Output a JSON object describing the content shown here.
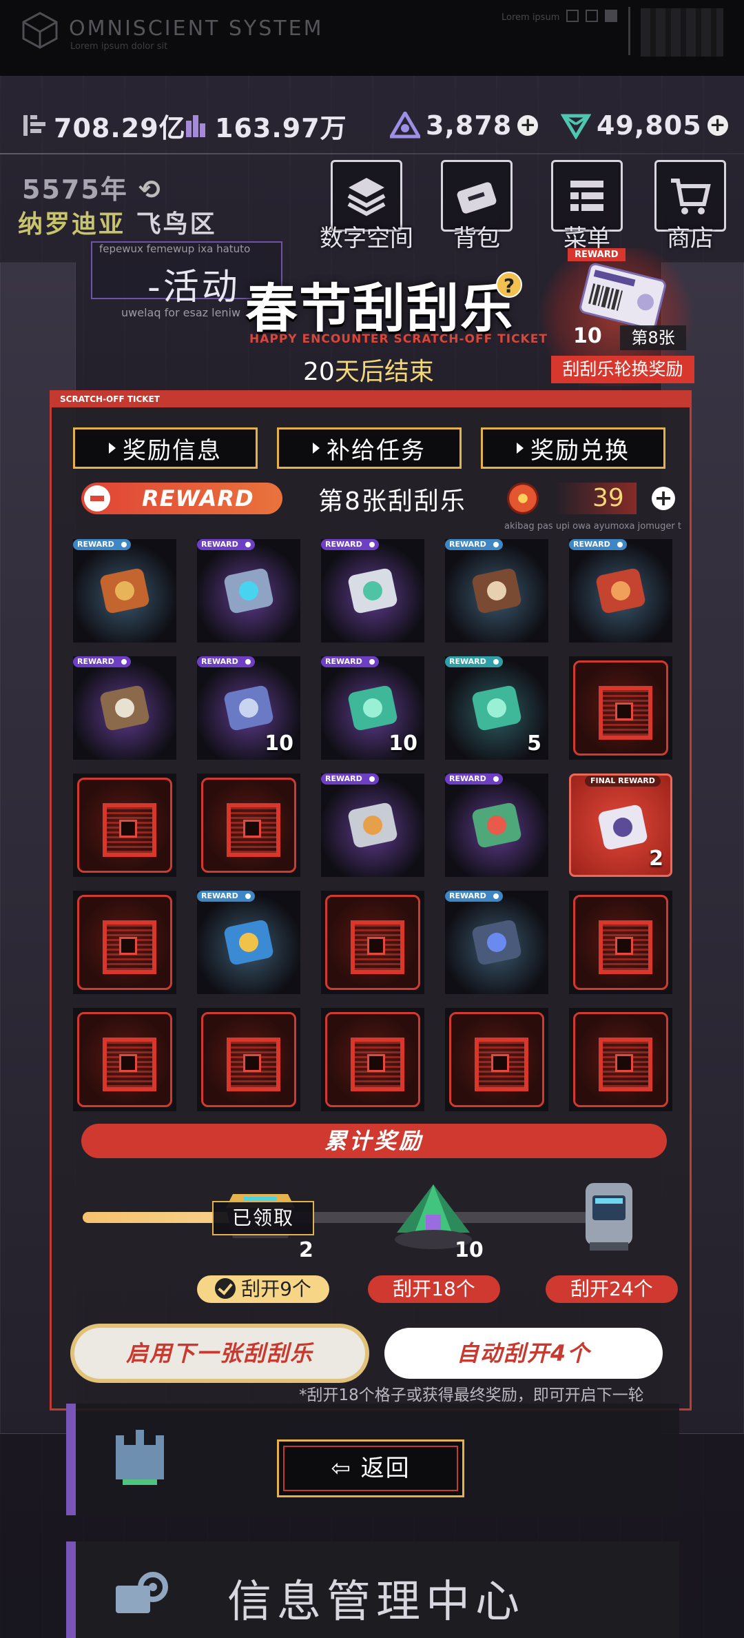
{
  "header": {
    "title": "OMNISCIENT SYSTEM",
    "subtitle": "Lorem ipsum dolor sit",
    "small_text": "Lorem ipsum"
  },
  "currencies": [
    {
      "name": "stack-icon",
      "value": "708.29亿"
    },
    {
      "name": "city-icon",
      "value": "163.97万"
    },
    {
      "name": "triangle-gem-icon",
      "value": "3,878"
    },
    {
      "name": "crystal-icon",
      "value": "49,805"
    }
  ],
  "location": {
    "year": "5575年",
    "region": "纳罗迪亚",
    "district": "飞鸟区"
  },
  "nav": [
    {
      "label": "数字空间",
      "icon": "layers-icon"
    },
    {
      "label": "背包",
      "icon": "bag-icon"
    },
    {
      "label": "菜单",
      "icon": "menu-icon"
    },
    {
      "label": "商店",
      "icon": "cart-icon"
    }
  ],
  "activity": {
    "label": "-活动",
    "small_top": "fepewux femewup ixa hatuto",
    "small_bottom": "uwelaq for esaz leniw"
  },
  "event": {
    "title": "春节刮刮乐",
    "subtitle": "HAPPY ENCOUNTER SCRATCH-OFF TICKET",
    "days": "20",
    "ends_text": "天后结束"
  },
  "round_reward": {
    "tag": "REWARD",
    "count": "10",
    "nth": "第8张",
    "label": "刮刮乐轮换奖励"
  },
  "panel": {
    "header": "SCRATCH-OFF TICKET",
    "tabs": [
      "奖励信息",
      "补给任务",
      "奖励兑换"
    ],
    "reward_label": "REWARD",
    "ticket_no": "第8张刮刮乐",
    "coins": "39",
    "coin_note": "akibag pas upi owa ayumoxa jomuger t"
  },
  "grid": {
    "cells": [
      {
        "state": "revealed",
        "tag": "REWARD",
        "tone": "blue",
        "icon": "firecracker-icon",
        "qty": ""
      },
      {
        "state": "revealed",
        "tag": "REWARD",
        "tone": "purple",
        "icon": "core-device-icon",
        "qty": ""
      },
      {
        "state": "revealed",
        "tag": "REWARD",
        "tone": "purple",
        "icon": "glue-gun-icon",
        "qty": ""
      },
      {
        "state": "revealed",
        "tag": "REWARD",
        "tone": "blue",
        "icon": "food-crate-icon",
        "qty": ""
      },
      {
        "state": "revealed",
        "tag": "REWARD",
        "tone": "blue",
        "icon": "red-chip-icon",
        "qty": ""
      },
      {
        "state": "revealed",
        "tag": "REWARD",
        "tone": "purple",
        "icon": "code-module-icon",
        "qty": ""
      },
      {
        "state": "revealed",
        "tag": "REWARD",
        "tone": "purple",
        "icon": "blueprint-card-icon",
        "qty": "10"
      },
      {
        "state": "revealed",
        "tag": "REWARD",
        "tone": "purple",
        "icon": "hologram-face-icon",
        "qty": "10"
      },
      {
        "state": "revealed",
        "tag": "REWARD",
        "tone": "teal",
        "icon": "hologram-face-icon",
        "qty": "5"
      },
      {
        "state": "locked"
      },
      {
        "state": "locked"
      },
      {
        "state": "locked"
      },
      {
        "state": "revealed",
        "tag": "REWARD",
        "tone": "purple",
        "icon": "blaster-icon",
        "qty": ""
      },
      {
        "state": "revealed",
        "tag": "REWARD",
        "tone": "purple",
        "icon": "syringe-icon",
        "qty": ""
      },
      {
        "state": "final",
        "tag": "FINAL REWARD",
        "icon": "ticket-icon",
        "qty": "2"
      },
      {
        "state": "locked"
      },
      {
        "state": "revealed",
        "tag": "REWARD",
        "tone": "blue",
        "icon": "mystery-box-icon",
        "qty": ""
      },
      {
        "state": "locked"
      },
      {
        "state": "revealed",
        "tag": "REWARD",
        "tone": "blue",
        "icon": "data-chip-icon",
        "qty": ""
      },
      {
        "state": "locked"
      },
      {
        "state": "locked"
      },
      {
        "state": "locked"
      },
      {
        "state": "locked"
      },
      {
        "state": "locked"
      },
      {
        "state": "locked"
      }
    ]
  },
  "accumulate": {
    "title": "累计奖励",
    "progress_fraction": 0.375,
    "claimed_label": "已领取",
    "milestones": [
      {
        "qty": "2",
        "label": "刮开9个",
        "done": true
      },
      {
        "qty": "10",
        "label": "刮开18个",
        "done": false
      },
      {
        "qty": "",
        "label": "刮开24个",
        "done": false
      }
    ]
  },
  "actions": {
    "next_ticket": "启用下一张刮刮乐",
    "auto_scratch": "自动刮开4个",
    "footnote": "*刮开18个格子或获得最终奖励，即可开启下一轮"
  },
  "bottom": {
    "back": "返回",
    "info_center": "信息管理中心"
  },
  "colors": {
    "accent_red": "#d0392f",
    "accent_gold": "#e4b24a",
    "bg": "#1a1820"
  }
}
